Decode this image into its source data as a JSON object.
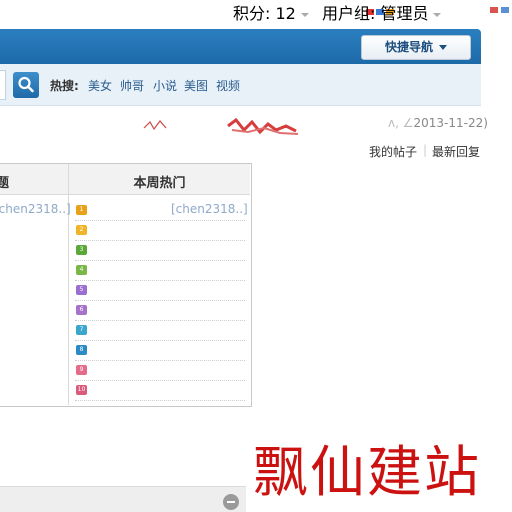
{
  "topbar": {
    "points_label": "积分: 12",
    "usergroup_label": "用户组: 管理员"
  },
  "navbar": {
    "quicknav_label": "快捷导航"
  },
  "search": {
    "hot_label": "热搜:",
    "hot_links": [
      "美女",
      "帅哥",
      "小说",
      "美图",
      "视频"
    ]
  },
  "info": {
    "date_text": "2013-11-22)",
    "my_posts": "我的帖子",
    "latest_reply": "最新回复"
  },
  "panel": {
    "left_header": "题",
    "right_header": "本周热门",
    "left_user": "[chen2318..]",
    "right_user": "[chen2318..]",
    "ranks": [
      "1",
      "2",
      "3",
      "4",
      "5",
      "6",
      "7",
      "8",
      "9",
      "10"
    ],
    "rank_colors": [
      "#e8a21a",
      "#f0b429",
      "#5aa83a",
      "#7ab648",
      "#9b6fd0",
      "#a772c9",
      "#3aa6c9",
      "#2b8ac4",
      "#e56b8a",
      "#d95a7a"
    ]
  },
  "watermark": "飘仙建站"
}
